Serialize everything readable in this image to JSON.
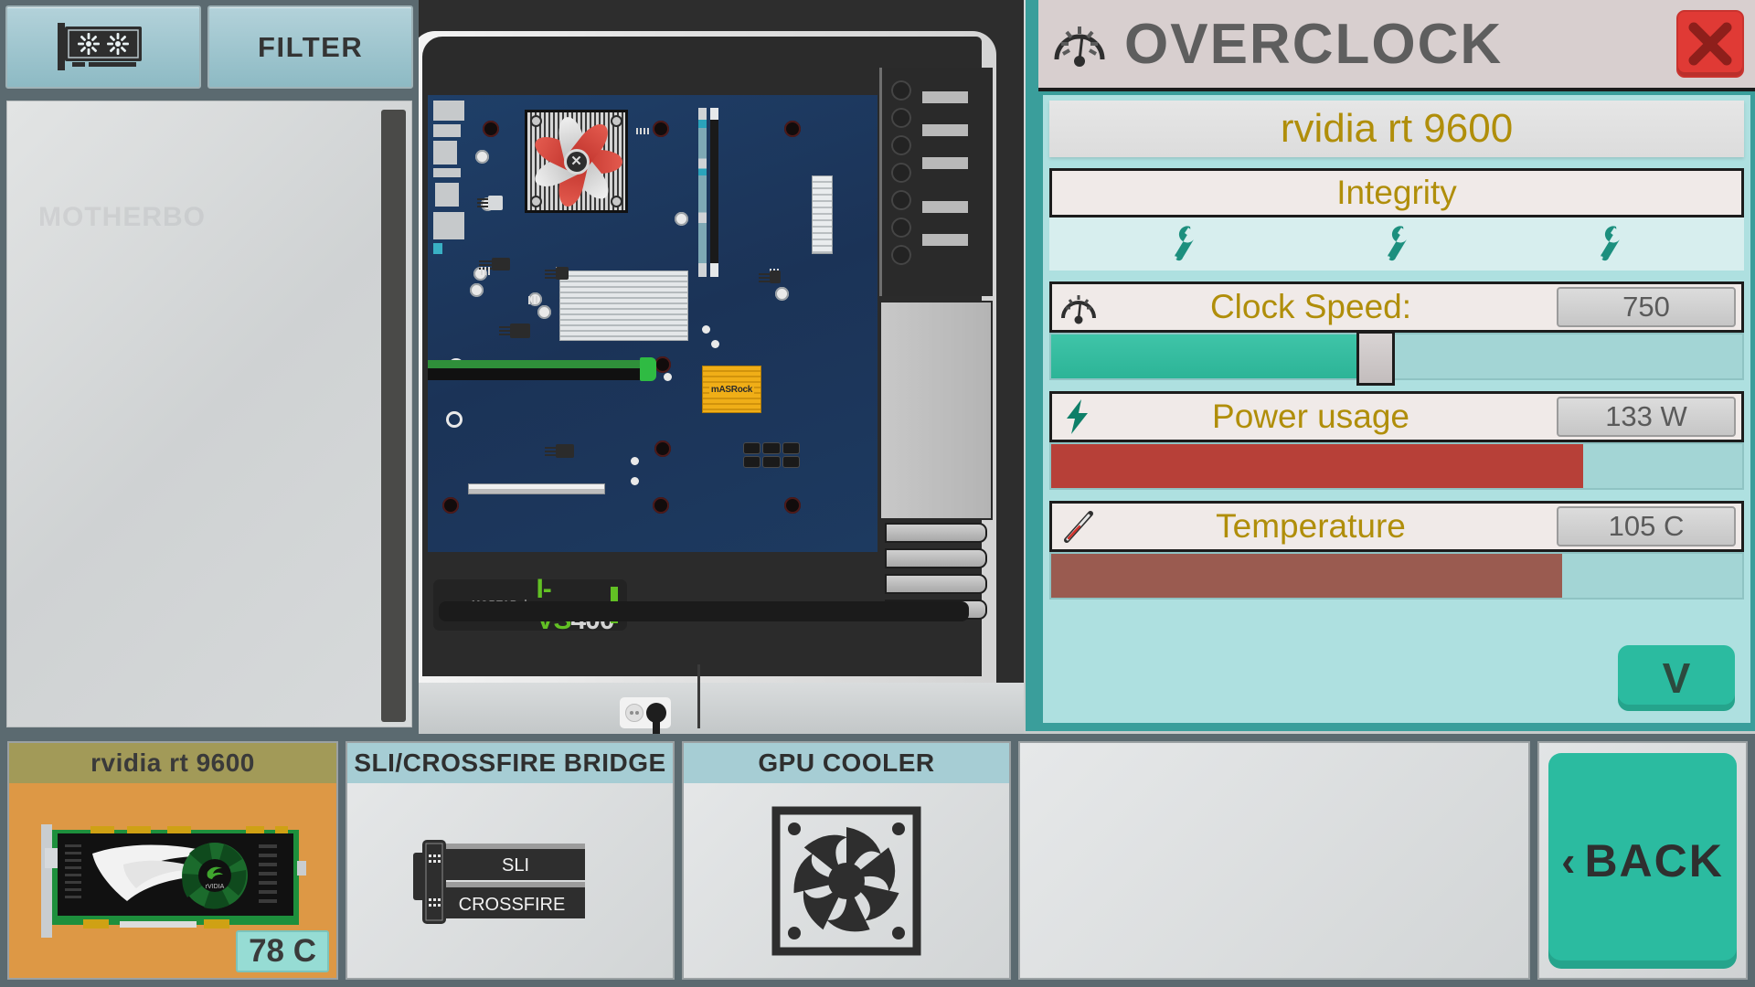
{
  "toolbar": {
    "gpu_button_icon": "gpu-card-icon",
    "filter_label": "FILTER"
  },
  "list_panel": {
    "ghost_label": "MOTHERBO"
  },
  "case": {
    "psu_brand": "MORTAR",
    "psu_model_part1": "I-VS",
    "psu_model_part2": "400",
    "mobo_chip_label": "mASRock"
  },
  "overclock": {
    "title": "OVERCLOCK",
    "gauge_icon": "speedometer-icon",
    "close_icon": "close-x-icon",
    "component_name": "rvidia rt 9600",
    "integrity_label": "Integrity",
    "integrity_slots": [
      "wrench-icon",
      "wrench-icon",
      "wrench-icon"
    ],
    "clock": {
      "icon": "speedometer-icon",
      "label": "Clock Speed:",
      "value": "750",
      "slider_percent": 47
    },
    "power": {
      "icon": "lightning-bolt-icon",
      "label": "Power usage",
      "value": "133 W",
      "bar_percent": 77,
      "bar_color": "#b74038"
    },
    "temperature": {
      "icon": "thermometer-icon",
      "label": "Temperature",
      "value": "105 C",
      "bar_percent": 74,
      "bar_color": "#9a5b50"
    },
    "expand_button_label": "V"
  },
  "bottom_bar": {
    "cards": [
      {
        "title": "rvidia rt 9600",
        "icon": "gpu-card-image",
        "temp_badge": "78 C"
      },
      {
        "title": "SLI/CROSSFIRE BRIDGE",
        "icon": "sli-bridge-image",
        "sli_label": "SLI",
        "crossfire_label": "CROSSFIRE"
      },
      {
        "title": "GPU COOLER",
        "icon": "fan-image"
      }
    ],
    "back_button": {
      "chevron": "‹",
      "label": "BACK"
    }
  },
  "colors": {
    "panel_teal": "#3a9e9b",
    "body_teal": "#aee0e0",
    "accent_green": "#2bbba0",
    "gold_text": "#b08e0a",
    "red_close": "#e03a35"
  }
}
